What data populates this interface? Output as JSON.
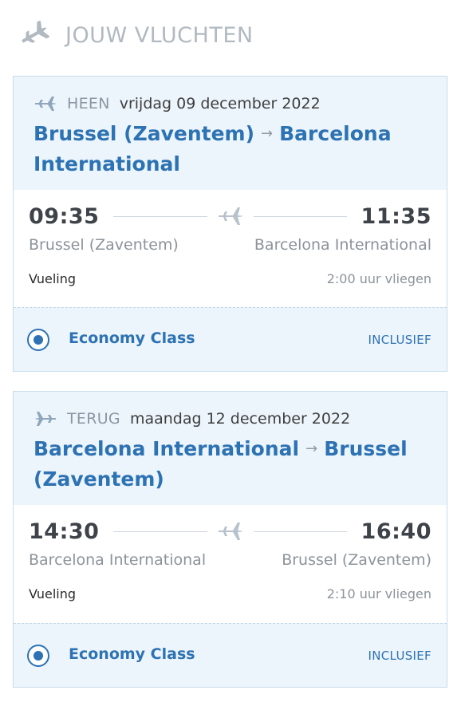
{
  "header": {
    "title": "JOUW VLUCHTEN",
    "icon": "airplane-icon"
  },
  "flights": [
    {
      "direction": "HEEN",
      "date": "vrijdag 09 december 2022",
      "route_from": "Brussel (Zaventem)",
      "route_arrow": "→",
      "route_to": "Barcelona International",
      "depart_time": "09:35",
      "arrive_time": "11:35",
      "depart_airport": "Brussel (Zaventem)",
      "arrive_airport": "Barcelona International",
      "carrier": "Vueling",
      "duration": "2:00 uur vliegen",
      "class_name": "Economy Class",
      "class_price": "INCLUSIEF"
    },
    {
      "direction": "TERUG",
      "date": "maandag 12 december 2022",
      "route_from": "Barcelona International",
      "route_arrow": "→",
      "route_to": "Brussel (Zaventem)",
      "depart_time": "14:30",
      "arrive_time": "16:40",
      "depart_airport": "Barcelona International",
      "arrive_airport": "Brussel (Zaventem)",
      "carrier": "Vueling",
      "duration": "2:10 uur vliegen",
      "class_name": "Economy Class",
      "class_price": "INCLUSIEF"
    }
  ],
  "colors": {
    "accent": "#2d72b3",
    "panel": "#edf5fc",
    "border": "#c7dceb",
    "muted": "#8c939a"
  }
}
